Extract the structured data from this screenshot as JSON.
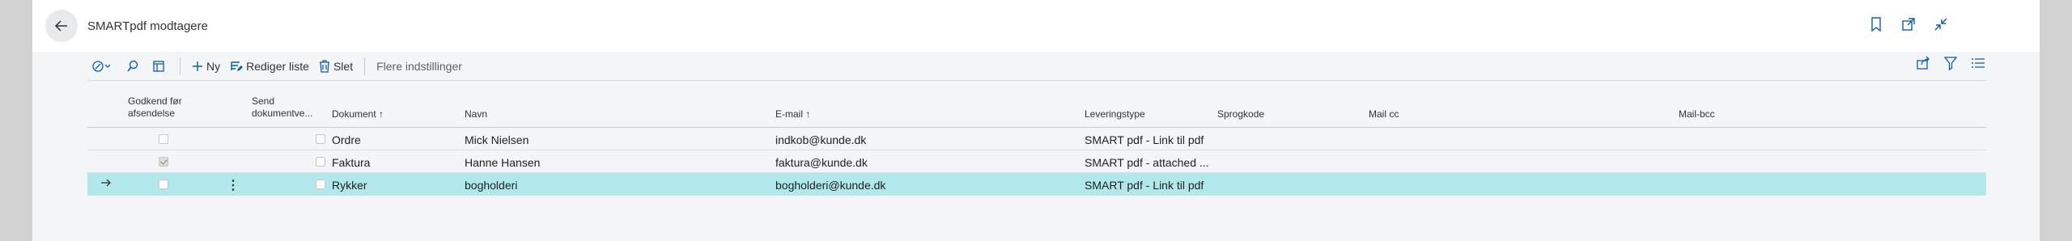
{
  "header": {
    "title": "SMARTpdf modtagere",
    "back_icon": "arrow-left-icon",
    "icons": [
      "bookmark-icon",
      "open-in-new-icon",
      "collapse-icon"
    ]
  },
  "toolbar": {
    "new_label": "Ny",
    "edit_list_label": "Rediger liste",
    "delete_label": "Slet",
    "more_label": "Flere indstillinger"
  },
  "columns": {
    "approve_line1": "Godkend før",
    "approve_line2": "afsendelse",
    "send_line1": "Send",
    "send_line2": "dokumentve...",
    "document": "Dokument ↑",
    "name": "Navn",
    "email": "E-mail ↑",
    "delivery": "Leveringstype",
    "language": "Sprogkode",
    "mail_cc": "Mail cc",
    "mail_bcc": "Mail-bcc"
  },
  "rows": [
    {
      "document": "Ordre",
      "name": "Mick Nielsen",
      "email": "indkob@kunde.dk",
      "delivery": "SMART pdf - Link til pdf",
      "approve": false,
      "send": false
    },
    {
      "document": "Faktura",
      "name": "Hanne Hansen",
      "email": "faktura@kunde.dk",
      "delivery": "SMART pdf - attached ...",
      "approve": true,
      "send": false
    },
    {
      "document": "Rykker",
      "name": "bogholderi",
      "email": "bogholderi@kunde.dk",
      "delivery": "SMART pdf - Link til pdf",
      "approve": false,
      "send": false
    }
  ],
  "colors": {
    "selected_row": "#b2e8ec",
    "accent": "#0078d4"
  }
}
